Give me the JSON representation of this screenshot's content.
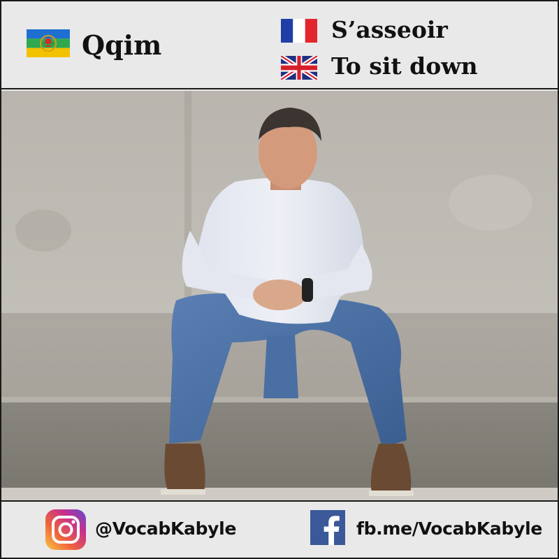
{
  "header": {
    "kabyle": {
      "flag": "kabyle-flag",
      "word": "Qqim"
    },
    "french": {
      "flag": "french-flag",
      "word": "S’asseoir"
    },
    "english": {
      "flag": "uk-flag",
      "word": "To sit down"
    }
  },
  "photo": {
    "subject": "man-sitting-on-concrete-step"
  },
  "footer": {
    "instagram": {
      "icon": "instagram-icon",
      "handle": "@VocabKabyle"
    },
    "facebook": {
      "icon": "facebook-icon",
      "handle": "fb.me/VocabKabyle"
    }
  },
  "colors": {
    "background": "#e9e9e9",
    "border": "#1a1a1a",
    "text": "#111111",
    "facebook_blue": "#3b5998"
  }
}
